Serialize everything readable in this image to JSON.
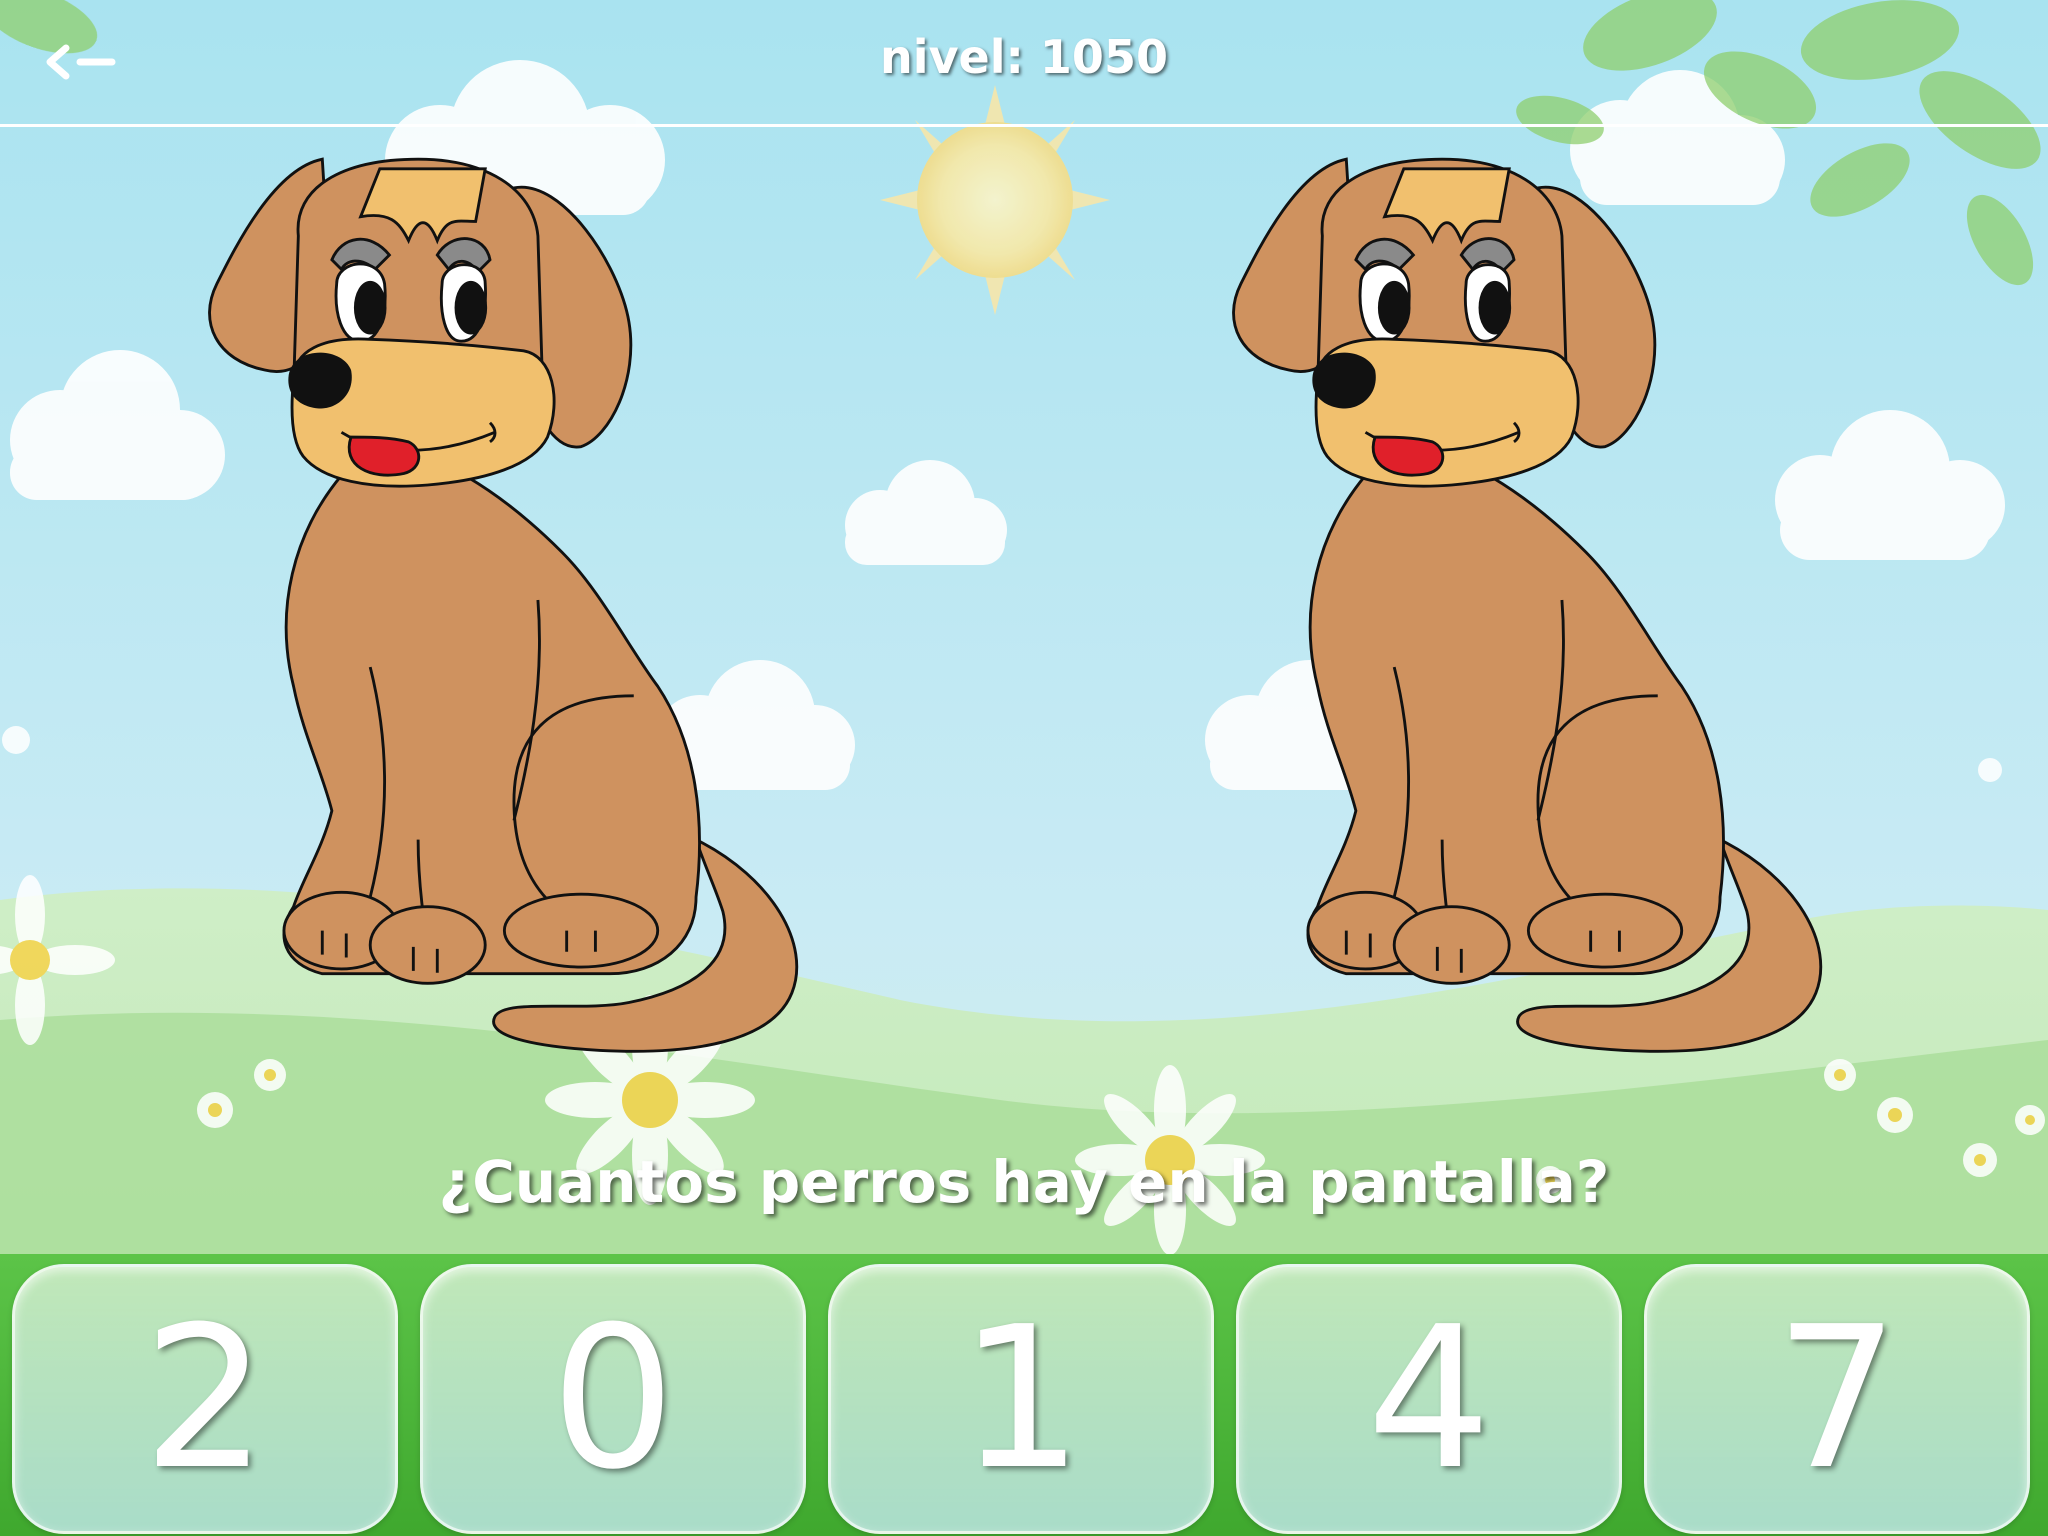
{
  "header": {
    "back_label": "<—",
    "level_text": "nivel: 1050"
  },
  "question": "¿Cuantos perros hay en la pantalla?",
  "answers": [
    {
      "label": "2"
    },
    {
      "label": "0"
    },
    {
      "label": "1"
    },
    {
      "label": "4"
    },
    {
      "label": "7"
    }
  ],
  "dogs": {
    "count": 2,
    "icon": "dog-icon"
  },
  "colors": {
    "sky": "#bfe6f1",
    "grass": "#5cc448",
    "dog_body": "#cf925f",
    "dog_muzzle": "#f1c06e",
    "tongue": "#e0202a"
  }
}
